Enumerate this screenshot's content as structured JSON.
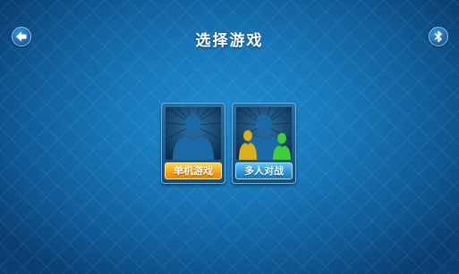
{
  "header": {
    "title": "选择游戏",
    "back_icon": "back-arrow-icon",
    "bluetooth_icon": "bluetooth-icon"
  },
  "modes": [
    {
      "label": "单机游戏",
      "icon": "single-player-icon",
      "color": "#f7a51a"
    },
    {
      "label": "多人对战",
      "icon": "multiplayer-icon",
      "color": "#2c98dc"
    }
  ],
  "colors": {
    "background": "#1777b8",
    "player_yellow": "#d9b21a",
    "player_green": "#3fcf3a",
    "silhouette": "#1a6aa8"
  }
}
